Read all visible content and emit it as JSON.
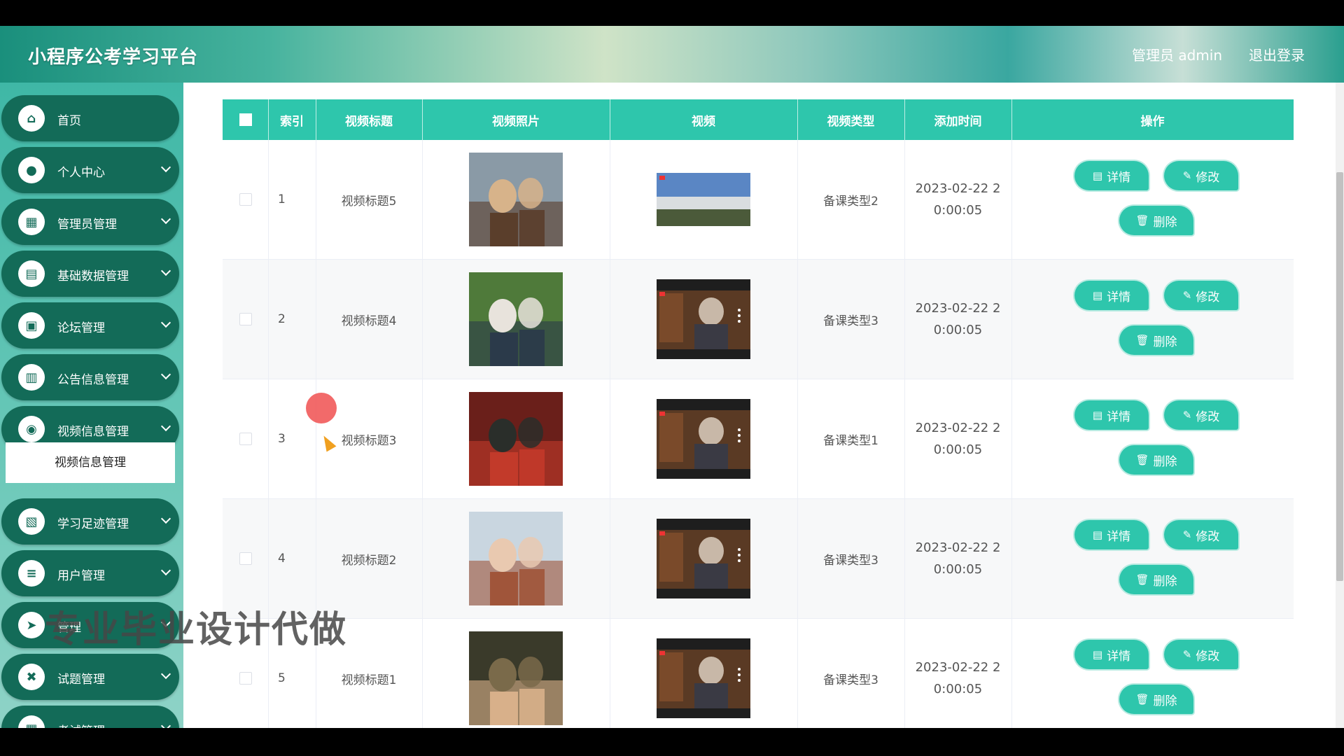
{
  "header": {
    "title": "小程序公考学习平台",
    "user": "管理员 admin",
    "logout": "退出登录"
  },
  "sidebar": {
    "items": [
      {
        "label": "首页",
        "icon": "home-icon",
        "glyph": "⌂"
      },
      {
        "label": "个人中心",
        "icon": "user-icon",
        "glyph": "●"
      },
      {
        "label": "管理员管理",
        "icon": "grid-icon",
        "glyph": "▦"
      },
      {
        "label": "基础数据管理",
        "icon": "briefcase-icon",
        "glyph": "▤"
      },
      {
        "label": "论坛管理",
        "icon": "wallet-icon",
        "glyph": "▣"
      },
      {
        "label": "公告信息管理",
        "icon": "clipboard-icon",
        "glyph": "▥"
      },
      {
        "label": "视频信息管理",
        "icon": "location-icon",
        "glyph": "◉"
      },
      {
        "label": "学习足迹管理",
        "icon": "calendar-icon",
        "glyph": "▧"
      },
      {
        "label": "用户管理",
        "icon": "sliders-icon",
        "glyph": "≡"
      },
      {
        "label": "管理",
        "icon": "send-icon",
        "glyph": "➤"
      },
      {
        "label": "试题管理",
        "icon": "ticket-icon",
        "glyph": "✖"
      },
      {
        "label": "考试管理",
        "icon": "grid-icon",
        "glyph": "▦"
      }
    ],
    "active_sub": "视频信息管理"
  },
  "table": {
    "headers": [
      "索引",
      "视频标题",
      "视频照片",
      "视频",
      "视频类型",
      "添加时间",
      "操作"
    ],
    "rows": [
      {
        "index": "1",
        "title": "视频标题5",
        "type": "备课类型2",
        "time": "2023-02-22 20:00:05"
      },
      {
        "index": "2",
        "title": "视频标题4",
        "type": "备课类型3",
        "time": "2023-02-22 20:00:05"
      },
      {
        "index": "3",
        "title": "视频标题3",
        "type": "备课类型1",
        "time": "2023-02-22 20:00:05"
      },
      {
        "index": "4",
        "title": "视频标题2",
        "type": "备课类型3",
        "time": "2023-02-22 20:00:05"
      },
      {
        "index": "5",
        "title": "视频标题1",
        "type": "备课类型3",
        "time": "2023-02-22 20:00:05"
      }
    ],
    "buttons": {
      "detail": "详情",
      "edit": "修改",
      "delete": "删除"
    }
  },
  "watermark": "专业毕业设计代做",
  "colors": {
    "accent": "#2ec6ac",
    "nav": "#136b58"
  }
}
